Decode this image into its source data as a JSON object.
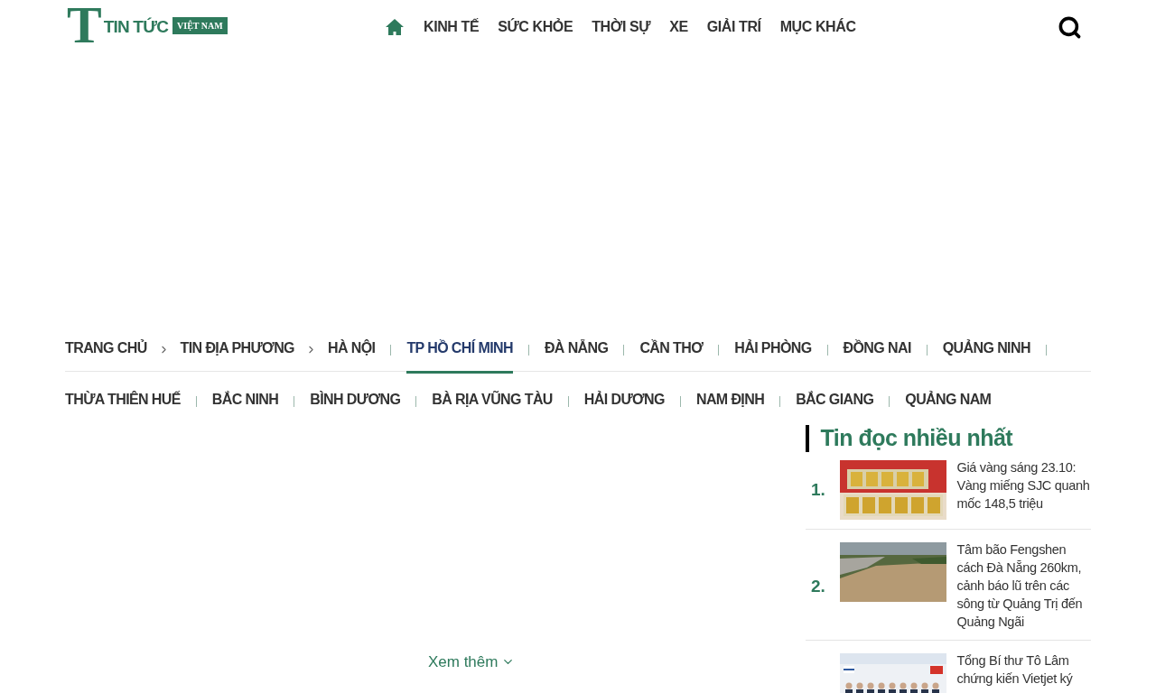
{
  "header": {
    "logo": {
      "letter": "T",
      "name": "TIN TỨC",
      "tag": "VIỆT NAM"
    },
    "nav": [
      {
        "kind": "home"
      },
      {
        "kind": "link",
        "label": "KINH TẾ"
      },
      {
        "kind": "link",
        "label": "SỨC KHỎE"
      },
      {
        "kind": "link",
        "label": "THỜI SỰ"
      },
      {
        "kind": "link",
        "label": "XE"
      },
      {
        "kind": "link",
        "label": "GIẢI TRÍ"
      },
      {
        "kind": "link",
        "label": "MỤC KHÁC"
      }
    ]
  },
  "local_nav": {
    "breadcrumb": [
      "TRANG CHỦ",
      "TIN ĐỊA PHƯƠNG"
    ],
    "region_rows": [
      [
        {
          "label": "HÀ NỘI",
          "selected": false
        },
        {
          "label": "TP HỒ CHÍ MINH",
          "selected": true
        },
        {
          "label": "ĐÀ NẴNG",
          "selected": false
        },
        {
          "label": "CẦN THƠ",
          "selected": false
        },
        {
          "label": "HẢI PHÒNG",
          "selected": false
        },
        {
          "label": "ĐỒNG NAI",
          "selected": false
        },
        {
          "label": "QUẢNG NINH",
          "selected": false
        }
      ],
      [
        {
          "label": "THỪA THIÊN HUẾ",
          "selected": false
        },
        {
          "label": "BẮC NINH",
          "selected": false
        },
        {
          "label": "BÌNH DƯƠNG",
          "selected": false
        },
        {
          "label": "BÀ RỊA VŨNG TÀU",
          "selected": false
        },
        {
          "label": "HẢI DƯƠNG",
          "selected": false
        },
        {
          "label": "NAM ĐỊNH",
          "selected": false
        },
        {
          "label": "BẮC GIANG",
          "selected": false
        },
        {
          "label": "QUẢNG NAM",
          "selected": false
        }
      ]
    ]
  },
  "main": {
    "more_link": "Xem thêm"
  },
  "sidebar": {
    "title": "Tin đọc nhiều nhất",
    "items": [
      {
        "rank": "1.",
        "title": "Giá vàng sáng 23.10: Vàng miếng SJC quanh mốc 148,5 triệu"
      },
      {
        "rank": "2.",
        "title": "Tâm bão Fengshen cách Đà Nẵng 260km, cảnh báo lũ trên các sông từ Quảng Trị đến Quảng Ngãi"
      },
      {
        "title": "Tổng Bí thư Tô Lâm chứng kiến Vietjet ký"
      }
    ]
  }
}
